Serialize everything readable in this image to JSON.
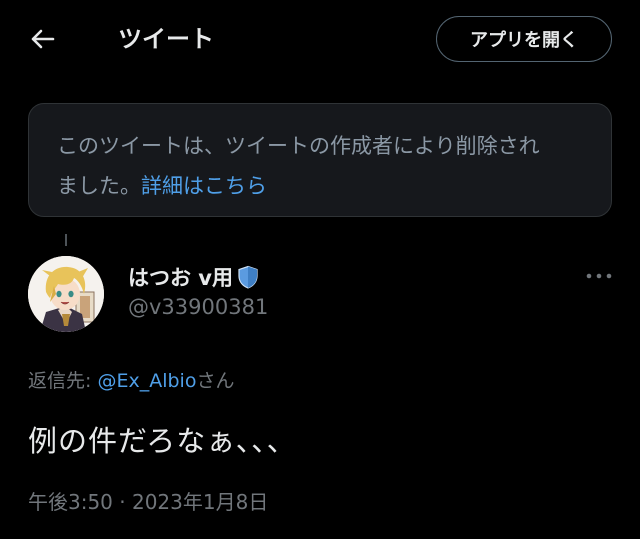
{
  "header": {
    "title": "ツイート",
    "open_app_label": "アプリを開く"
  },
  "deleted_notice": {
    "line1": "このツイートは、ツイートの作成者により削除され",
    "line2_prefix": "ました。",
    "learn_more": "詳細はこちら"
  },
  "tweet": {
    "display_name": "はつお v用",
    "handle": "@v33900381",
    "reply_prefix": "返信先: ",
    "reply_mention": "@Ex_Albio",
    "reply_suffix": "さん",
    "text": "例の件だろなぁ、、、",
    "timestamp": "午後3:50 · 2023年1月8日"
  },
  "icons": {
    "back": "back-arrow-icon",
    "badge": "shield-badge-icon",
    "more": "more-dots-icon"
  },
  "colors": {
    "background": "#000000",
    "text": "#e7e9ea",
    "secondary": "#71767b",
    "link": "#4f9fe8",
    "notice_bg": "#16181c"
  }
}
